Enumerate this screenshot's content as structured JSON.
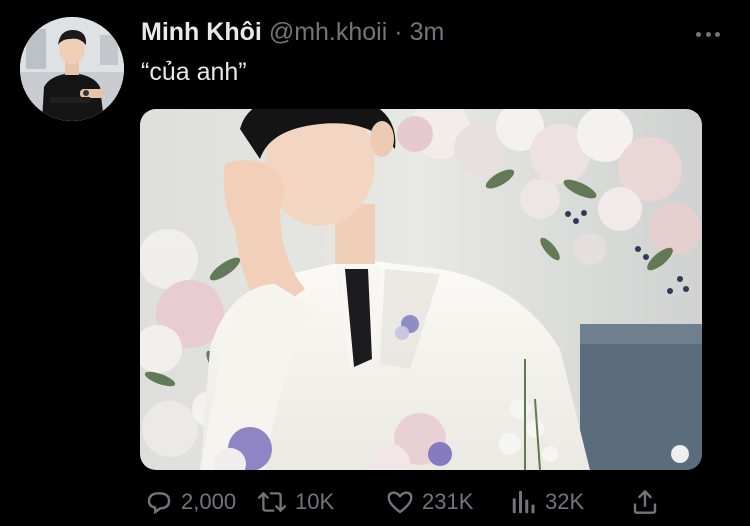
{
  "tweet": {
    "display_name": "Minh Khôi",
    "handle": "@mh.khoii",
    "separator": "·",
    "time": "3m",
    "text": "“của anh”",
    "avatar_icon": "profile-photo",
    "more_icon": "more-horizontal-icon",
    "media_alt": "photo"
  },
  "actions": {
    "reply": {
      "icon": "reply-icon",
      "count": "2,000"
    },
    "retweet": {
      "icon": "retweet-icon",
      "count": "10K"
    },
    "like": {
      "icon": "heart-icon",
      "count": "231K"
    },
    "views": {
      "icon": "views-chart-icon",
      "count": "32K"
    },
    "share": {
      "icon": "share-icon"
    }
  },
  "colors": {
    "background": "#000000",
    "primary_text": "#e7e9ea",
    "secondary_text": "#71767b"
  }
}
